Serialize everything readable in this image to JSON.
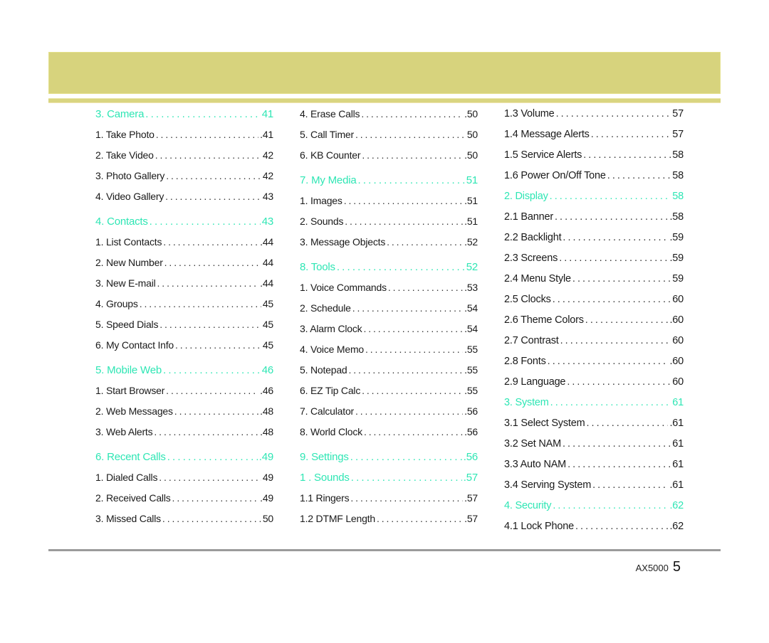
{
  "colors": {
    "heading": "#2ee6b4",
    "banner": "#d7d37d",
    "rule": "#9b9b9b"
  },
  "columns": [
    {
      "rows": [
        {
          "label": "3. Camera",
          "page": "41",
          "head": true
        },
        {
          "label": "1. Take Photo",
          "page": ".41"
        },
        {
          "label": "2. Take Video",
          "page": "42"
        },
        {
          "label": "3. Photo Gallery",
          "page": "42"
        },
        {
          "label": "4. Video Gallery",
          "page": "43"
        },
        {
          "label": "4. Contacts",
          "page": "43",
          "head": true,
          "gap": true
        },
        {
          "label": "1. List Contacts",
          "page": ".44"
        },
        {
          "label": "2. New Number",
          "page": "44"
        },
        {
          "label": "3. New E-mail",
          "page": ".44"
        },
        {
          "label": "4. Groups",
          "page": "45"
        },
        {
          "label": "5. Speed Dials",
          "page": "45"
        },
        {
          "label": "6. My Contact Info",
          "page": "45"
        },
        {
          "label": "5. Mobile Web",
          "page": "46",
          "head": true,
          "gap": true
        },
        {
          "label": "1. Start Browser",
          "page": ".46"
        },
        {
          "label": "2. Web Messages",
          "page": ".48"
        },
        {
          "label": "3. Web Alerts",
          "page": ".48"
        },
        {
          "label": "6. Recent Calls",
          "page": ".49",
          "head": true,
          "gap": true
        },
        {
          "label": "1. Dialed Calls",
          "page": "49"
        },
        {
          "label": "2. Received Calls",
          "page": ".49"
        },
        {
          "label": "3. Missed Calls",
          "page": "50"
        }
      ]
    },
    {
      "rows": [
        {
          "label": "4. Erase Calls",
          "page": ".50"
        },
        {
          "label": "5. Call Timer",
          "page": "50"
        },
        {
          "label": "6. KB Counter",
          "page": ".50"
        },
        {
          "label": "7. My Media",
          "page": "51",
          "head": true,
          "gap": true
        },
        {
          "label": "1. Images",
          "page": ".51"
        },
        {
          "label": "2. Sounds",
          "page": ".51"
        },
        {
          "label": "3. Message Objects",
          "page": ".52"
        },
        {
          "label": "8. Tools",
          "page": "52",
          "head": true,
          "gap": true
        },
        {
          "label": "1. Voice Commands",
          "page": ".53"
        },
        {
          "label": "2. Schedule",
          "page": ".54"
        },
        {
          "label": "3. Alarm Clock",
          "page": ".54"
        },
        {
          "label": "4. Voice Memo",
          "page": ".55"
        },
        {
          "label": "5. Notepad",
          "page": ".55"
        },
        {
          "label": "6. EZ Tip Calc",
          "page": ".55"
        },
        {
          "label": "7. Calculator",
          "page": ".56"
        },
        {
          "label": "8. World Clock",
          "page": ".56"
        },
        {
          "label": "9. Settings",
          "page": ".56",
          "head": true,
          "gap": true
        },
        {
          "label": "1 . Sounds",
          "page": ".57",
          "head": true
        },
        {
          "label": "1.1 Ringers",
          "page": ".57"
        },
        {
          "label": "1.2 DTMF Length",
          "page": ".57"
        }
      ]
    },
    {
      "rows": [
        {
          "label": "1.3 Volume",
          "page": "57"
        },
        {
          "label": "1.4 Message Alerts",
          "page": "57"
        },
        {
          "label": "1.5 Service Alerts",
          "page": "58"
        },
        {
          "label": "1.6 Power On/Off Tone",
          "page": "58"
        },
        {
          "label": "2. Display",
          "page": "58",
          "head": true
        },
        {
          "label": "2.1 Banner",
          "page": ".58"
        },
        {
          "label": "2.2 Backlight",
          "page": ".59"
        },
        {
          "label": "2.3 Screens",
          "page": ".59"
        },
        {
          "label": "2.4 Menu Style",
          "page": "59"
        },
        {
          "label": "2.5 Clocks",
          "page": "60"
        },
        {
          "label": "2.6 Theme Colors",
          "page": ".60"
        },
        {
          "label": "2.7 Contrast",
          "page": "60"
        },
        {
          "label": "2.8 Fonts",
          "page": ".60"
        },
        {
          "label": "2.9 Language",
          "page": "60"
        },
        {
          "label": "3. System",
          "page": "61",
          "head": true
        },
        {
          "label": "3.1 Select System",
          "page": ".61"
        },
        {
          "label": "3.2 Set NAM",
          "page": "61"
        },
        {
          "label": "3.3 Auto NAM",
          "page": "61"
        },
        {
          "label": "3.4 Serving System",
          "page": ".61"
        },
        {
          "label": "4. Security",
          "page": ".62",
          "head": true
        },
        {
          "label": "4.1 Lock Phone",
          "page": ".62"
        }
      ]
    }
  ],
  "footer": {
    "model": "AX5000",
    "page_number": "5"
  }
}
